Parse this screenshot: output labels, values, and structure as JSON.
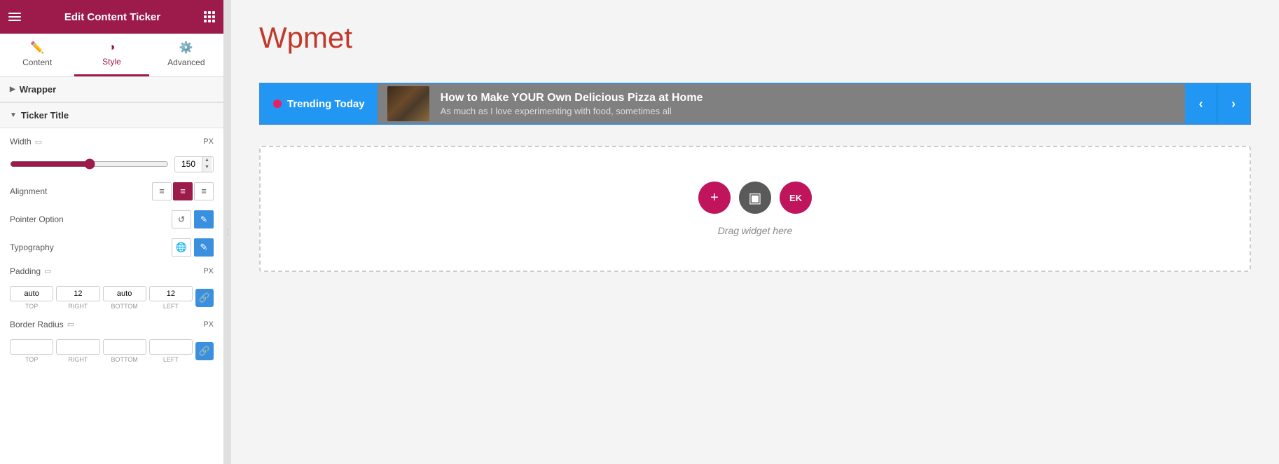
{
  "header": {
    "title": "Edit Content Ticker",
    "menuIcon": "menu-icon",
    "gridIcon": "grid-icon"
  },
  "tabs": [
    {
      "id": "content",
      "label": "Content",
      "icon": "✏️",
      "active": false
    },
    {
      "id": "style",
      "label": "Style",
      "icon": "◑",
      "active": true
    },
    {
      "id": "advanced",
      "label": "Advanced",
      "icon": "⚙️",
      "active": false
    }
  ],
  "sections": {
    "wrapper": {
      "label": "Wrapper",
      "collapsed": true
    },
    "tickerTitle": {
      "label": "Ticker Title",
      "collapsed": false,
      "width": {
        "label": "Width",
        "unit": "PX",
        "value": 150
      },
      "alignment": {
        "label": "Alignment",
        "options": [
          "left",
          "center",
          "right"
        ],
        "active": "center"
      },
      "pointerOption": {
        "label": "Pointer Option",
        "options": [
          "reset",
          "edit"
        ],
        "active": "edit"
      },
      "typography": {
        "label": "Typography",
        "options": [
          "global",
          "edit"
        ]
      },
      "padding": {
        "label": "Padding",
        "unit": "PX",
        "top": "auto",
        "right": "12",
        "bottom": "auto",
        "left": "12",
        "linked": true
      },
      "borderRadius": {
        "label": "Border Radius",
        "unit": "PX",
        "top": "",
        "right": "",
        "bottom": "",
        "left": "",
        "linked": true
      }
    }
  },
  "preview": {
    "pageTitle": "Wpmet",
    "ticker": {
      "labelText": "Trending Today",
      "headline": "How to Make YOUR Own Delicious Pizza at Home",
      "subline": "As much as I love experimenting with food, sometimes all",
      "prevBtn": "‹",
      "nextBtn": "›"
    },
    "dropZone": {
      "text": "Drag widget here",
      "buttons": [
        {
          "id": "add",
          "icon": "+",
          "type": "add"
        },
        {
          "id": "folder",
          "icon": "▣",
          "type": "folder"
        },
        {
          "id": "ek",
          "icon": "EK",
          "type": "ek"
        }
      ]
    }
  }
}
